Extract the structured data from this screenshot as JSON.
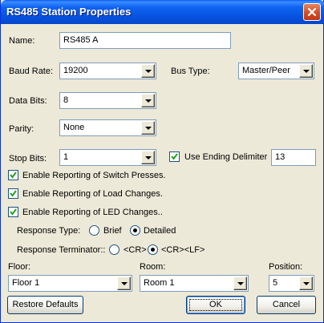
{
  "window": {
    "title": "RS485 Station Properties"
  },
  "name": {
    "label": "Name:",
    "value": "RS485 A"
  },
  "baud_rate": {
    "label": "Baud Rate:",
    "value": "19200"
  },
  "bus_type": {
    "label": "Bus Type:",
    "value": "Master/Peer"
  },
  "data_bits": {
    "label": "Data Bits:",
    "value": "8"
  },
  "parity": {
    "label": "Parity:",
    "value": "None"
  },
  "stop_bits": {
    "label": "Stop Bits:",
    "value": "1"
  },
  "ending_delimiter": {
    "label": "Use Ending Delimiter",
    "checked": true,
    "value": "13"
  },
  "reporting": [
    {
      "label": "Enable  Reporting of Switch Presses.",
      "checked": true
    },
    {
      "label": "Enable Reporting of Load Changes.",
      "checked": true
    },
    {
      "label": "Enable Reporting of LED Changes..",
      "checked": true
    }
  ],
  "response_type": {
    "label": "Response Type:",
    "options": [
      {
        "label": "Brief",
        "selected": false
      },
      {
        "label": "Detailed",
        "selected": true
      }
    ]
  },
  "response_terminator": {
    "label": "Response Terminator::",
    "options": [
      {
        "label": "<CR>",
        "selected": false
      },
      {
        "label": "<CR><LF>",
        "selected": true
      }
    ]
  },
  "floor": {
    "label": "Floor:",
    "value": "Floor 1"
  },
  "room": {
    "label": "Room:",
    "value": "Room 1"
  },
  "position": {
    "label": "Position:",
    "value": "5"
  },
  "buttons": {
    "restore_defaults": "Restore Defaults",
    "ok": "OK",
    "cancel": "Cancel"
  },
  "colors": {
    "titlebar": "#0752e0",
    "dialog_bg": "#ece9d8",
    "field_border": "#7f9db9",
    "close_button": "#cf4a22"
  }
}
